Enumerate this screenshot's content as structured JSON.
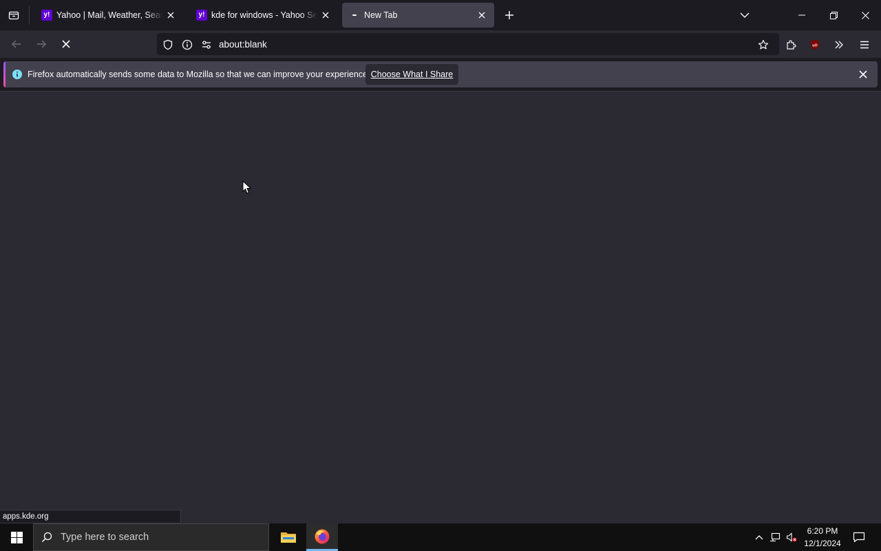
{
  "browser": {
    "tabs": [
      {
        "title": "Yahoo | Mail, Weather, Search, Politics",
        "favicon": "yahoo-icon",
        "selected": false
      },
      {
        "title": "kde for windows - Yahoo Search",
        "favicon": "yahoo-icon",
        "selected": false
      },
      {
        "title": "New Tab",
        "favicon": "loading-dot-icon",
        "selected": true
      }
    ],
    "favicon_letter": "y!",
    "address": "about:blank",
    "notification": {
      "message": "Firefox automatically sends some data to Mozilla so that we can improve your experience.",
      "button_label": "Choose What I Share"
    },
    "status_url": "apps.kde.org",
    "colors": {
      "accent": "#9059ff",
      "notification_bg": "#42414d",
      "content_bg": "#2b2a33"
    }
  },
  "taskbar": {
    "search_placeholder": "Type here to search",
    "time": "6:20 PM",
    "date": "12/1/2024",
    "apps": [
      "file-explorer-icon",
      "firefox-icon"
    ]
  }
}
